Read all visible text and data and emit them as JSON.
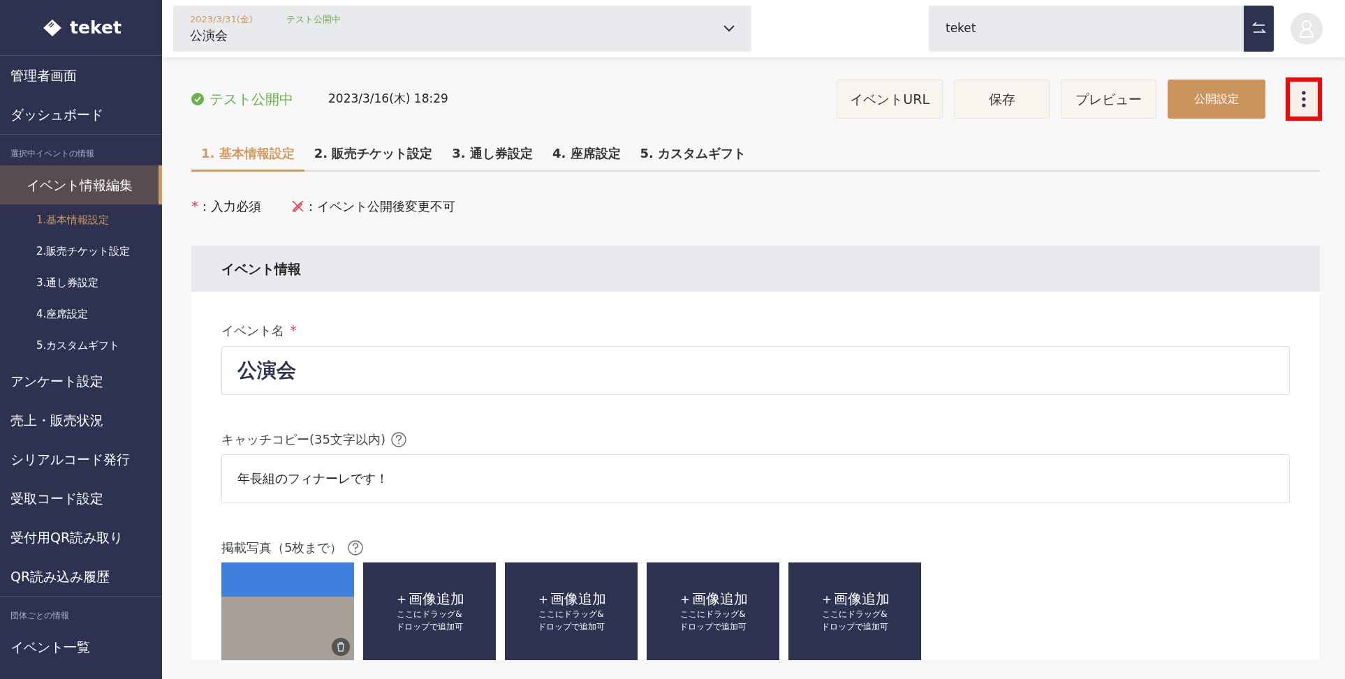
{
  "sidebar": {
    "logo": "teket",
    "groups": [
      {
        "items": [
          {
            "label": "管理者画面",
            "selected": false
          },
          {
            "label": "ダッシュボード",
            "selected": false
          }
        ]
      },
      {
        "heading": "選択中イベントの情報",
        "items": [
          {
            "label": "イベント情報編集",
            "selected": true,
            "children": [
              {
                "label": "1.基本情報設定",
                "selected": true
              },
              {
                "label": "2.販売チケット設定",
                "selected": false
              },
              {
                "label": "3.通し券設定",
                "selected": false
              },
              {
                "label": "4.座席設定",
                "selected": false
              },
              {
                "label": "5.カスタムギフト",
                "selected": false
              }
            ]
          },
          {
            "label": "アンケート設定",
            "selected": false
          },
          {
            "label": "売上・販売状況",
            "selected": false
          },
          {
            "label": "シリアルコード発行",
            "selected": false
          },
          {
            "label": "受取コード設定",
            "selected": false
          },
          {
            "label": "受付用QR読み取り",
            "selected": false
          },
          {
            "label": "QR読み込み履歴",
            "selected": false
          }
        ]
      },
      {
        "heading": "団体ごとの情報",
        "items": [
          {
            "label": "イベント一覧",
            "selected": false
          }
        ]
      }
    ]
  },
  "topbar": {
    "event_selector": {
      "date": "2023/3/31(金)",
      "status": "テスト公開中",
      "name": "公演会"
    },
    "organization_field": {
      "value": "teket"
    }
  },
  "header": {
    "status": "テスト公開中",
    "updated": "2023/3/16(木) 18:29",
    "buttons": [
      {
        "label": "イベントURL",
        "kind": "light"
      },
      {
        "label": "保存",
        "kind": "light"
      },
      {
        "label": "プレビュー",
        "kind": "light"
      },
      {
        "label": "公開設定",
        "kind": "primary"
      }
    ],
    "more_button": {
      "highlighted": true
    }
  },
  "tabs": [
    {
      "label": "1. 基本情報設定",
      "selected": true
    },
    {
      "label": "2. 販売チケット設定",
      "selected": false
    },
    {
      "label": "3. 通し券設定",
      "selected": false
    },
    {
      "label": "4. 座席設定",
      "selected": false
    },
    {
      "label": "5. カスタムギフト",
      "selected": false
    }
  ],
  "legend": [
    {
      "kind": "required",
      "mark": "*",
      "text": "：入力必須"
    },
    {
      "kind": "locked",
      "text": "：イベント公開後変更不可"
    }
  ],
  "card": {
    "title": "イベント情報",
    "fields": [
      {
        "label": "イベント名",
        "required_mark": "*",
        "value": "公演会",
        "kind": "large"
      },
      {
        "label": "キャッチコピー(35文字以内)",
        "help": true,
        "value": "年長組のフィナーレです！",
        "kind": "normal"
      }
    ],
    "photos": {
      "label": "掲載写真（5枚まで）",
      "help": true,
      "slots": [
        {
          "kind": "photo"
        },
        {
          "kind": "add",
          "title": "＋画像追加",
          "hint_lines": [
            "ここにドラッグ&",
            "ドロップで追加可"
          ]
        },
        {
          "kind": "add",
          "title": "＋画像追加",
          "hint_lines": [
            "ここにドラッグ&",
            "ドロップで追加可"
          ]
        },
        {
          "kind": "add",
          "title": "＋画像追加",
          "hint_lines": [
            "ここにドラッグ&",
            "ドロップで追加可"
          ]
        },
        {
          "kind": "add",
          "title": "＋画像追加",
          "hint_lines": [
            "ここにドラッグ&",
            "ドロップで追加可"
          ]
        }
      ]
    }
  }
}
